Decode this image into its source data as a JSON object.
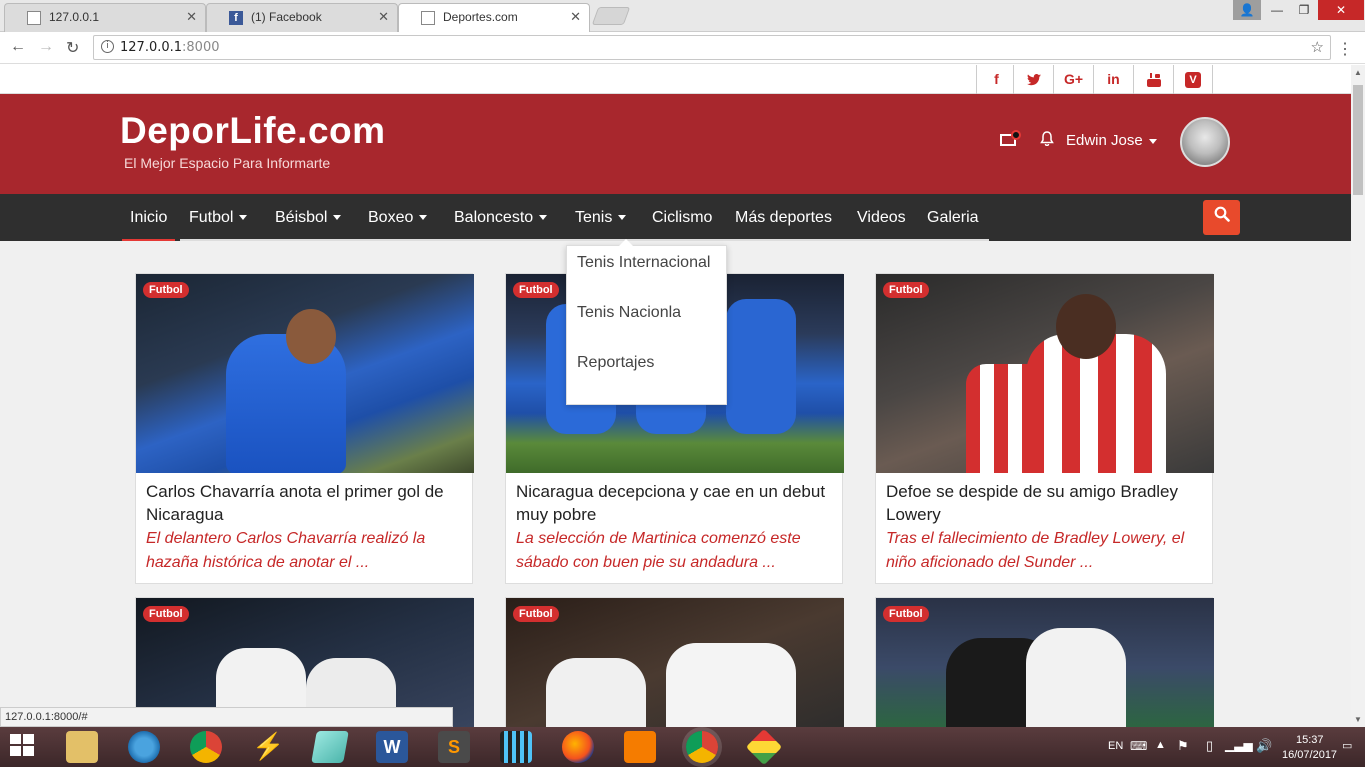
{
  "browser": {
    "tabs": [
      {
        "title": "127.0.0.1"
      },
      {
        "title": "(1) Facebook"
      },
      {
        "title": "Deportes.com"
      }
    ],
    "url_host": "127.0.0.1",
    "url_port": ":8000",
    "status_url": "127.0.0.1:8000/#"
  },
  "site": {
    "logo": "DeporLife.com",
    "tagline": "El Mejor Espacio Para Informarte",
    "user_name": "Edwin Jose",
    "social": [
      "f",
      "t",
      "g+",
      "in",
      "yt",
      "v"
    ]
  },
  "nav": {
    "items": [
      {
        "label": "Inicio"
      },
      {
        "label": "Futbol"
      },
      {
        "label": "Béisbol"
      },
      {
        "label": "Boxeo"
      },
      {
        "label": "Baloncesto"
      },
      {
        "label": "Tenis"
      },
      {
        "label": "Ciclismo"
      },
      {
        "label": "Más deportes"
      },
      {
        "label": "Videos"
      },
      {
        "label": "Galeria"
      }
    ],
    "active": "Inicio",
    "open_dropdown": "Tenis"
  },
  "dropdown": {
    "items": [
      {
        "label": "Tenis Internacional"
      },
      {
        "label": "Tenis Nacionla"
      },
      {
        "label": "Reportajes"
      }
    ]
  },
  "cards": [
    {
      "badge": "Futbol",
      "title": "Carlos Chavarría anota el primer gol de Nicaragua",
      "desc": "El delantero Carlos Chavarría realizó la hazaña histórica de anotar el ..."
    },
    {
      "badge": "Futbol",
      "title": "Nicaragua decepciona y cae en un debut muy pobre",
      "desc": "La selección de Martinica comenzó este sábado con buen pie su andadura ..."
    },
    {
      "badge": "Futbol",
      "title": "Defoe se despide de su amigo Bradley Lowery",
      "desc": "Tras el fallecimiento de Bradley Lowery, el niño aficionado del Sunder ..."
    },
    {
      "badge": "Futbol"
    },
    {
      "badge": "Futbol"
    },
    {
      "badge": "Futbol"
    }
  ],
  "taskbar": {
    "lang": "EN",
    "time": "15:37",
    "date": "16/07/2017"
  },
  "colors": {
    "header": "#a8272d",
    "navbar": "#2f2f2f",
    "accent": "#e84a2c",
    "badge": "#d32f2f",
    "desc": "#c62828"
  }
}
